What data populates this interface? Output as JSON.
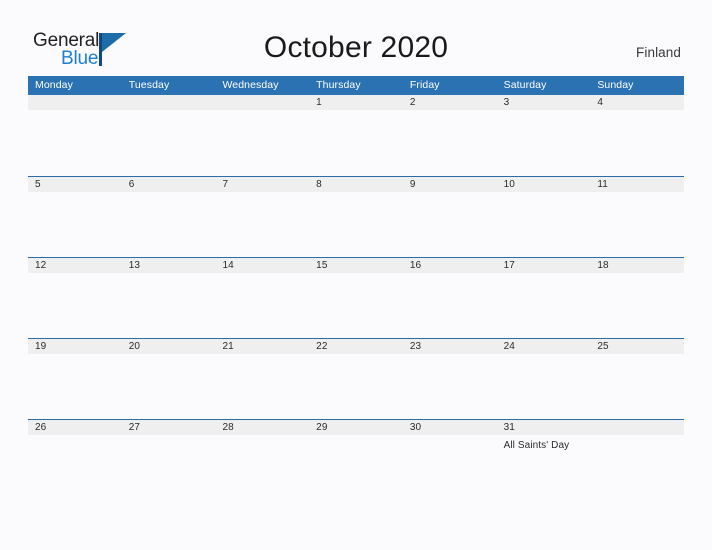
{
  "brand": {
    "name_part1": "General",
    "name_part2": "Blue",
    "accent_color": "#1c7fd4",
    "mark_color": "#1b6ca8"
  },
  "header": {
    "title": "October 2020",
    "region": "Finland"
  },
  "calendar": {
    "header_color": "#2b72b3",
    "band_color": "#efefef",
    "rule_color": "#2e6da4",
    "weekdays": [
      "Monday",
      "Tuesday",
      "Wednesday",
      "Thursday",
      "Friday",
      "Saturday",
      "Sunday"
    ],
    "weeks": [
      {
        "days": [
          {
            "num": "",
            "event": ""
          },
          {
            "num": "",
            "event": ""
          },
          {
            "num": "",
            "event": ""
          },
          {
            "num": "1",
            "event": ""
          },
          {
            "num": "2",
            "event": ""
          },
          {
            "num": "3",
            "event": ""
          },
          {
            "num": "4",
            "event": ""
          }
        ]
      },
      {
        "days": [
          {
            "num": "5",
            "event": ""
          },
          {
            "num": "6",
            "event": ""
          },
          {
            "num": "7",
            "event": ""
          },
          {
            "num": "8",
            "event": ""
          },
          {
            "num": "9",
            "event": ""
          },
          {
            "num": "10",
            "event": ""
          },
          {
            "num": "11",
            "event": ""
          }
        ]
      },
      {
        "days": [
          {
            "num": "12",
            "event": ""
          },
          {
            "num": "13",
            "event": ""
          },
          {
            "num": "14",
            "event": ""
          },
          {
            "num": "15",
            "event": ""
          },
          {
            "num": "16",
            "event": ""
          },
          {
            "num": "17",
            "event": ""
          },
          {
            "num": "18",
            "event": ""
          }
        ]
      },
      {
        "days": [
          {
            "num": "19",
            "event": ""
          },
          {
            "num": "20",
            "event": ""
          },
          {
            "num": "21",
            "event": ""
          },
          {
            "num": "22",
            "event": ""
          },
          {
            "num": "23",
            "event": ""
          },
          {
            "num": "24",
            "event": ""
          },
          {
            "num": "25",
            "event": ""
          }
        ]
      },
      {
        "days": [
          {
            "num": "26",
            "event": ""
          },
          {
            "num": "27",
            "event": ""
          },
          {
            "num": "28",
            "event": ""
          },
          {
            "num": "29",
            "event": ""
          },
          {
            "num": "30",
            "event": ""
          },
          {
            "num": "31",
            "event": "All Saints' Day"
          },
          {
            "num": "",
            "event": ""
          }
        ]
      }
    ]
  }
}
